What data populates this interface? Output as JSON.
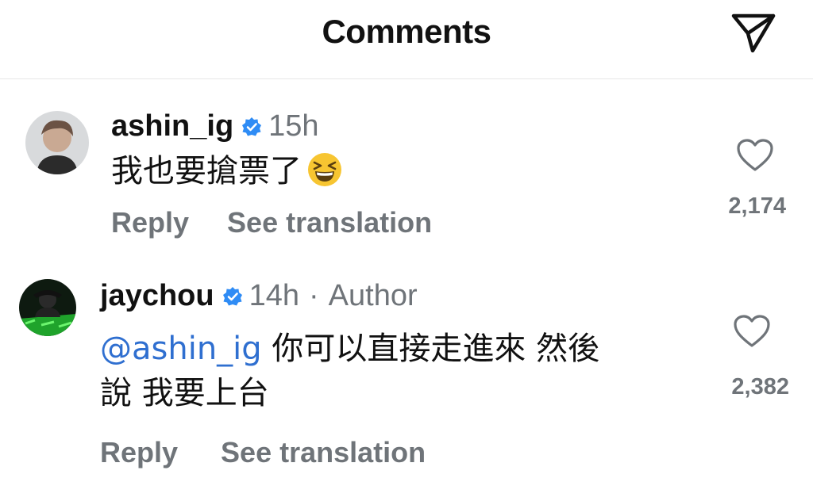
{
  "header": {
    "title": "Comments",
    "send_icon": "paper-plane-icon"
  },
  "comments": [
    {
      "username": "ashin_ig",
      "verified": true,
      "time": "15h",
      "text": "我也要搶票了",
      "emoji": "grinning-squinting-face",
      "reply_label": "Reply",
      "translate_label": "See translation",
      "likes": "2,174"
    },
    {
      "username": "jaychou",
      "verified": true,
      "time": "14h",
      "separator": "·",
      "author_label": "Author",
      "mention": "@ashin_ig",
      "text_line1": " 你可以直接走進來 然後",
      "text_line2": "說 我要上台",
      "reply_label": "Reply",
      "translate_label": "See translation",
      "likes": "2,382"
    }
  ],
  "colors": {
    "mention": "#2f6fd0",
    "verified": "#2f8cf5",
    "muted": "#6f7479"
  }
}
